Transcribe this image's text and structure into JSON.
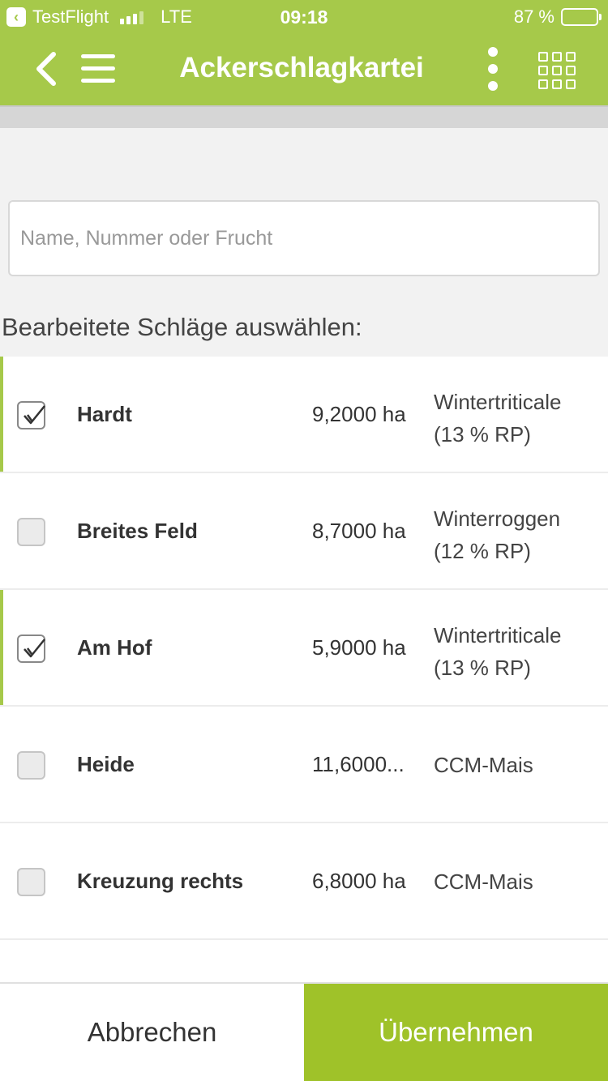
{
  "status_bar": {
    "app": "TestFlight",
    "network": "LTE",
    "time": "09:18",
    "battery": "87 %"
  },
  "nav": {
    "title": "Ackerschlagkartei"
  },
  "search": {
    "placeholder": "Name, Nummer oder Frucht"
  },
  "section_label": "Bearbeitete Schläge auswählen:",
  "fields": [
    {
      "name": "Hardt",
      "area": "9,2000 ha",
      "crop": "Wintertriticale (13 % RP)",
      "selected": true
    },
    {
      "name": "Breites Feld",
      "area": "8,7000 ha",
      "crop": "Winterroggen (12 % RP)",
      "selected": false
    },
    {
      "name": "Am Hof",
      "area": "5,9000 ha",
      "crop": "Wintertriticale (13 % RP)",
      "selected": true
    },
    {
      "name": "Heide",
      "area": "11,6000...",
      "crop": "CCM-Mais",
      "selected": false
    },
    {
      "name": "Kreuzung rechts",
      "area": "6,8000 ha",
      "crop": "CCM-Mais",
      "selected": false
    }
  ],
  "buttons": {
    "cancel": "Abbrechen",
    "apply": "Übernehmen"
  },
  "colors": {
    "accent": "#a6c94a",
    "apply_button": "#9fc229"
  },
  "icons": {
    "back": "chevron-left-icon",
    "menu": "hamburger-icon",
    "more": "more-vertical-icon",
    "grid": "grid-icon"
  }
}
